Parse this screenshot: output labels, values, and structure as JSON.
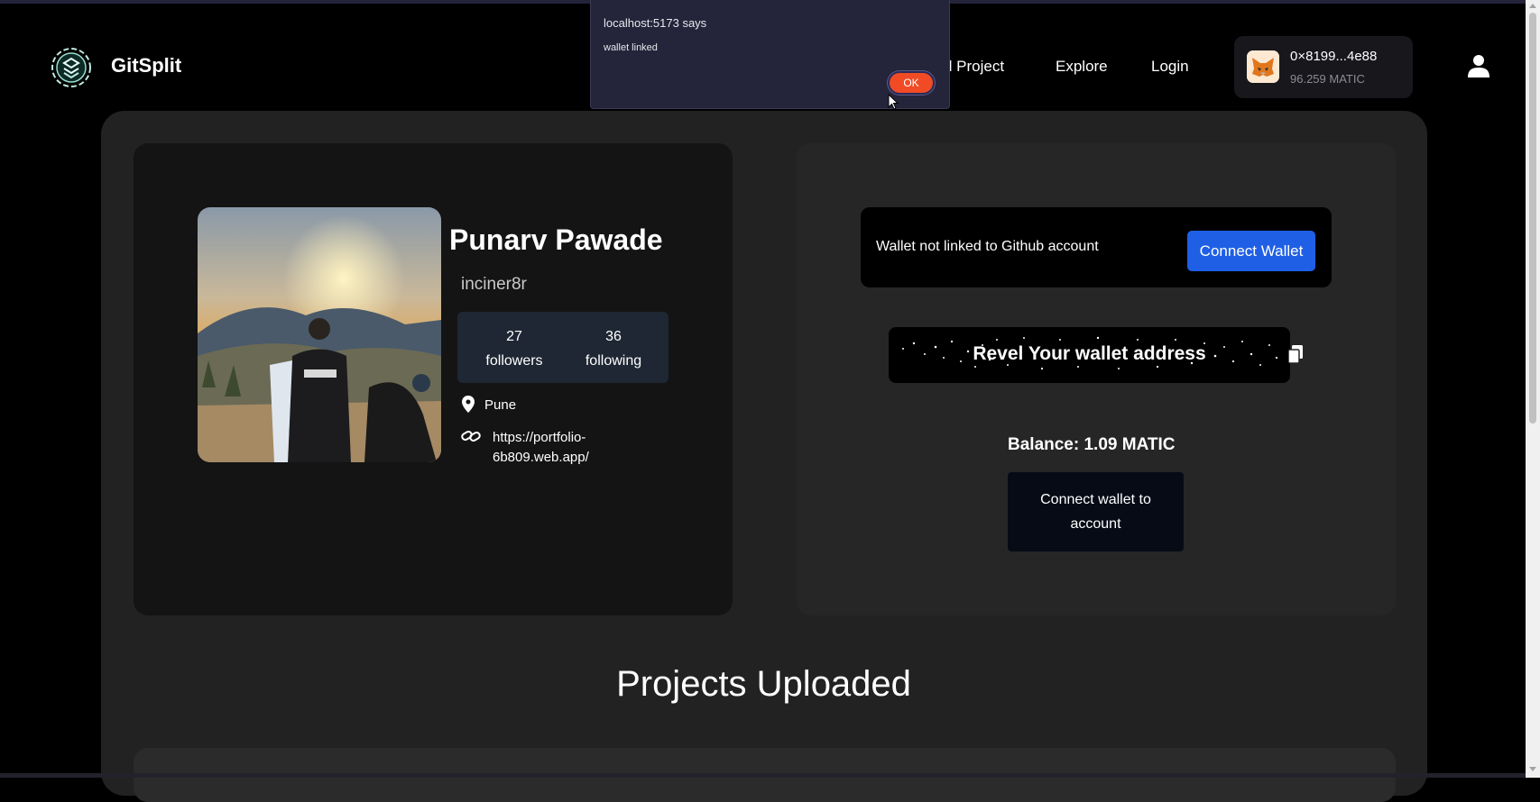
{
  "browser": {
    "alert": {
      "title": "localhost:5173 says",
      "message": "wallet linked",
      "ok_label": "OK"
    }
  },
  "nav": {
    "brand": "GitSplit",
    "links": [
      "d Project",
      "Explore",
      "Login"
    ],
    "wallet": {
      "address": "0×8199...4e88",
      "balance": "96.259 MATIC"
    },
    "icons": [
      "gitsplit-logo",
      "metamask-fox-icon",
      "user-icon"
    ]
  },
  "profile": {
    "name": "Punarv Pawade",
    "username": "inciner8r",
    "followers_count": "27",
    "followers_label": "followers",
    "following_count": "36",
    "following_label": "following",
    "location": "Pune",
    "website_line1": "https://portfolio-",
    "website_line2": "6b809.web.app/"
  },
  "wallet_panel": {
    "notice": "Wallet not linked to Github account",
    "connect_button": "Connect Wallet",
    "reveal_text": "Revel Your wallet address",
    "balance": "Balance: 1.09 MATIC",
    "link_button": "Connect wallet to account"
  },
  "projects": {
    "title": "Projects Uploaded"
  },
  "colors": {
    "accent_blue": "#1f5fe6",
    "alert_ok": "#f04b25",
    "panel": "#222222",
    "card_dark": "#141414"
  }
}
